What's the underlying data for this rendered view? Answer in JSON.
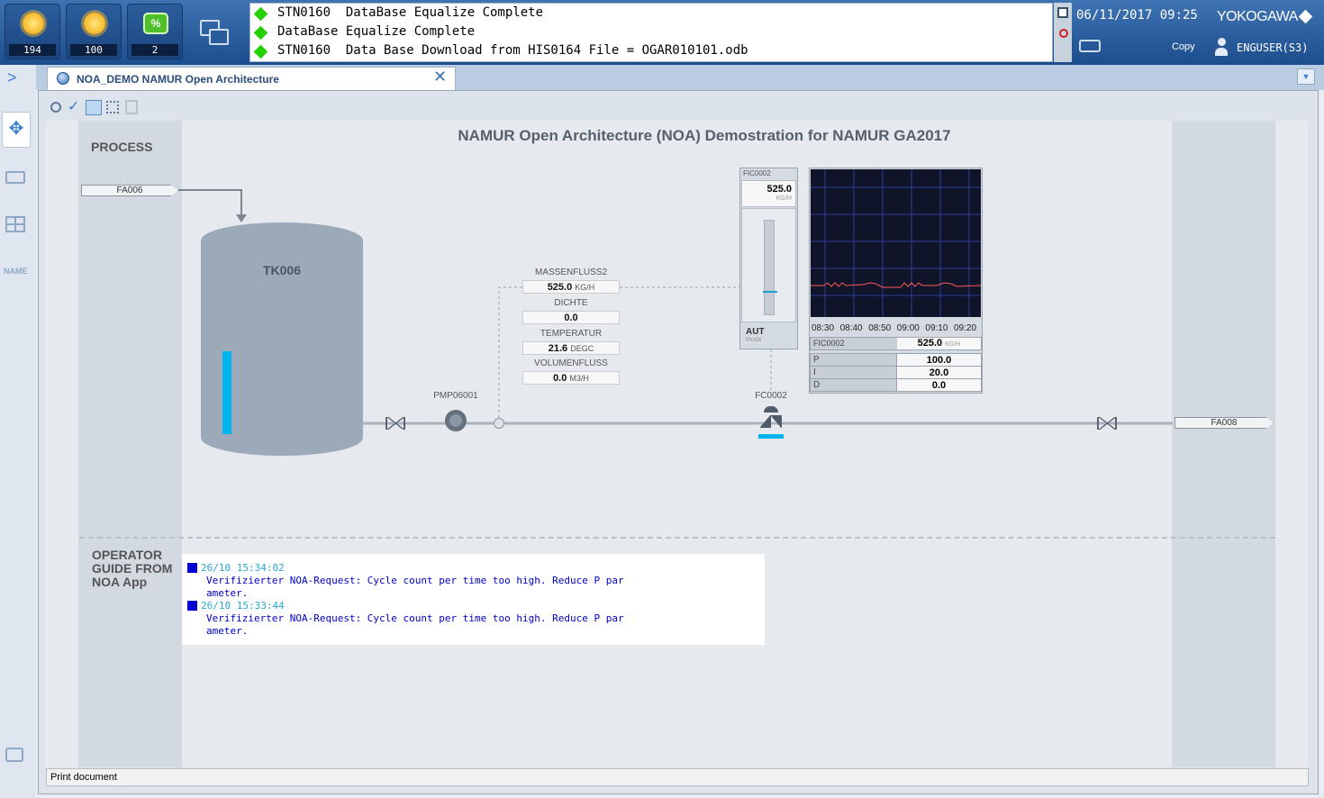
{
  "header": {
    "alarm_buttons": [
      {
        "count": "194",
        "icon": "process-alarm-icon"
      },
      {
        "count": "100",
        "icon": "system-alarm-icon"
      },
      {
        "count": "2",
        "icon": "operator-guide-icon"
      }
    ],
    "messages": [
      "STN0160  DataBase Equalize Complete",
      "DataBase Equalize Complete",
      "STN0160  Data Base Download from HIS0164 File = OGAR010101.odb"
    ],
    "datetime": "06/11/2017 09:25",
    "brand": "YOKOGAWA",
    "copy_label": "Copy",
    "user": "ENGUSER(S3)",
    "colors": {
      "accent": "#1c4d8d",
      "ok": "#23d100"
    }
  },
  "tab": {
    "title": "NOA_DEMO NAMUR Open Architecture"
  },
  "leftbar": {
    "name_label": "NAME"
  },
  "graphic": {
    "title": "NAMUR Open Architecture (NOA) Demostration for NAMUR GA2017",
    "process_label": "PROCESS",
    "guide_label": "OPERATOR GUIDE FROM NOA App",
    "inlet": "FA006",
    "outlet": "FA008",
    "tank": "TK006",
    "tank_level": 0.4,
    "pump": "PMP06001",
    "valve": "FC0002",
    "measurements": [
      {
        "label": "MASSENFLUSS2",
        "value": "525.0",
        "unit": "KG/H"
      },
      {
        "label": "DICHTE",
        "value": "0.0",
        "unit": ""
      },
      {
        "label": "TEMPERATUR",
        "value": "21.6",
        "unit": "DEGC"
      },
      {
        "label": "VOLUMENFLUSS",
        "value": "0.0",
        "unit": "M3/H"
      }
    ],
    "faceplate": {
      "tag": "FIC0002",
      "pv": "525.0",
      "unit": "KG/H",
      "mode": "AUT",
      "mode_label": "Mode",
      "bar_level": 0.25
    },
    "trend": {
      "times": [
        "08:30",
        "08:40",
        "08:50",
        "09:00",
        "09:10",
        "09:20"
      ],
      "tag": "FIC0002",
      "value": "525.0",
      "unit": "KG/H"
    },
    "pid": [
      {
        "name": "P",
        "value": "100.0"
      },
      {
        "name": "I",
        "value": "20.0"
      },
      {
        "name": "D",
        "value": "0.0"
      }
    ],
    "guide_messages": [
      {
        "time": "26/10 15:34:02",
        "lines": [
          "Verifizierter NOA-Request: Cycle count per time too high. Reduce P par",
          "ameter."
        ]
      },
      {
        "time": "26/10 15:33:44",
        "lines": [
          "Verifizierter NOA-Request: Cycle count per time too high. Reduce P par",
          "ameter."
        ]
      }
    ]
  },
  "statusbar": {
    "text": "Print document"
  }
}
